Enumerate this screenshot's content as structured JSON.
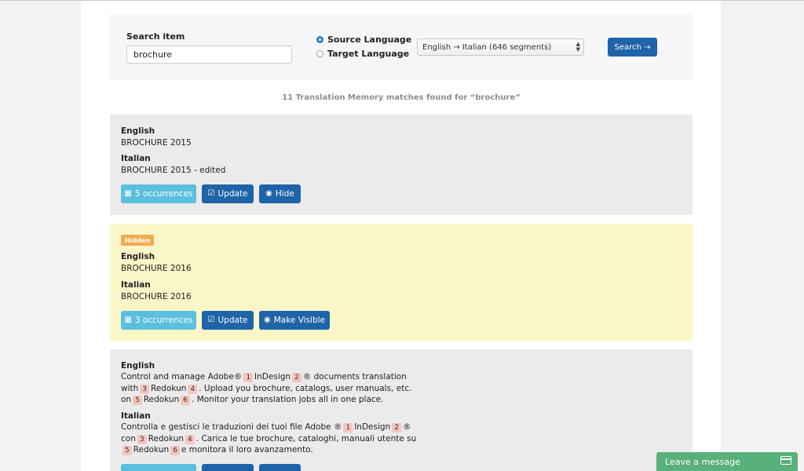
{
  "search": {
    "label": "Search item",
    "value": "brochure",
    "radio_source": "Source Language",
    "radio_target": "Target Language",
    "selected_radio": "source",
    "language_pair": "English → Italian (646 segments)",
    "button": "Search →"
  },
  "summary": "11 Translation Memory matches found for “brochure”",
  "results": [
    {
      "source_lang": "English",
      "source_text": "BROCHURE 2015",
      "target_lang": "Italian",
      "target_text": "BROCHURE 2015 - edited",
      "occurrences": "5 occurrences",
      "update": "Update",
      "toggle": "Hide"
    },
    {
      "badge": "Hidden",
      "source_lang": "English",
      "source_text": "BROCHURE 2016",
      "target_lang": "Italian",
      "target_text": "BROCHURE 2016",
      "occurrences": "3 occurrences",
      "update": "Update",
      "toggle": "Make Visible"
    },
    {
      "source_lang": "English",
      "source_lines": [
        [
          "Control and manage Adobe®",
          "1",
          "InDesign",
          "2",
          "® documents translation"
        ],
        [
          "with",
          "3",
          "Redokun",
          "4",
          ". Upload you brochure, catalogs, user manuals, etc."
        ],
        [
          "on",
          "5",
          "Redokun",
          "6",
          ". Monitor your translation jobs all in one place."
        ]
      ],
      "target_lang": "Italian",
      "target_lines": [
        [
          "Controlla e gestisci le traduzioni dei tuoi file Adobe ®",
          "1",
          "InDesign",
          "2",
          "®"
        ],
        [
          "con",
          "3",
          "Redokun",
          "4",
          ". Carica le tue brochure, cataloghi, manuali utente su"
        ],
        [
          "",
          "5",
          "Redokun",
          "6",
          "e monitora il loro avanzamento."
        ]
      ]
    }
  ],
  "livechat": "Leave a message",
  "colors": {
    "primary": "#1f63a8",
    "info": "#5bc0de",
    "hidden_bg": "#fbf6c8",
    "tag_bg": "#f5c6bb",
    "badge": "#f0ad4e",
    "chat": "#58b07a"
  }
}
